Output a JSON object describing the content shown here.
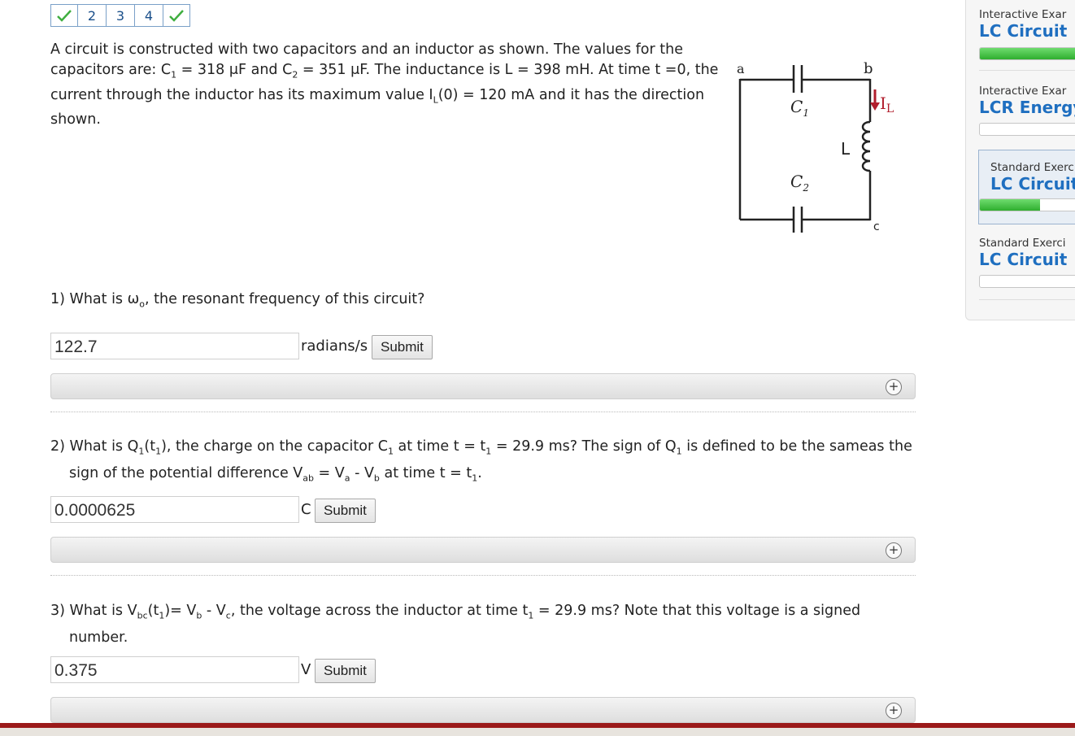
{
  "tabs": [
    {
      "label": "",
      "icon": "checkmark-icon"
    },
    {
      "label": "2"
    },
    {
      "label": "3"
    },
    {
      "label": "4"
    },
    {
      "label": "",
      "icon": "checkmark-icon"
    }
  ],
  "problem": {
    "p1": "A circuit is constructed with two capacitors and an inductor as shown. The values for the capacitors are: C",
    "s1": "1",
    "p2": " = 318 μF and C",
    "s2": "2",
    "p3": " = 351 μF. The inductance is L = 398 mH. At time t =0, the current through the inductor has its maximum value I",
    "s3": "L",
    "p4": "(0) = 120 mA and it has the direction shown."
  },
  "circuit": {
    "a": "a",
    "b": "b",
    "c": "c",
    "c1": "C",
    "c1_sub": "1",
    "c2": "C",
    "c2_sub": "2",
    "l": "L",
    "il": "I",
    "il_sub": "L",
    "arrow_color": "#b11e2d"
  },
  "questions": [
    {
      "line1": "1) What is ω",
      "sub1": "o",
      "rest1": ", the resonant frequency of this circuit?",
      "value": "122.7",
      "unit": "radians/s",
      "submit": "Submit"
    },
    {
      "line1": "2) What is Q",
      "value": "0.0000625",
      "unit": "C",
      "submit": "Submit"
    },
    {
      "line1": "3) What is V",
      "value": "0.375",
      "unit": "V",
      "submit": "Submit"
    }
  ],
  "hint_icon": "plus-circle-icon",
  "sidebar": [
    {
      "type": "Interactive Exar",
      "title": "LC Circuit",
      "progress": 1.0
    },
    {
      "type": "Interactive Exar",
      "title": "LCR Energy",
      "progress": 0.0
    },
    {
      "type": "Standard Exerci",
      "title": "LC Circuit",
      "progress": 0.62,
      "active": true
    },
    {
      "type": "Standard Exerci",
      "title": "LC Circuit",
      "progress": 0.0
    }
  ],
  "colors": {
    "accent": "#1f6fc0",
    "progress": "#2fae2f",
    "footer": "#9b1a1a"
  }
}
